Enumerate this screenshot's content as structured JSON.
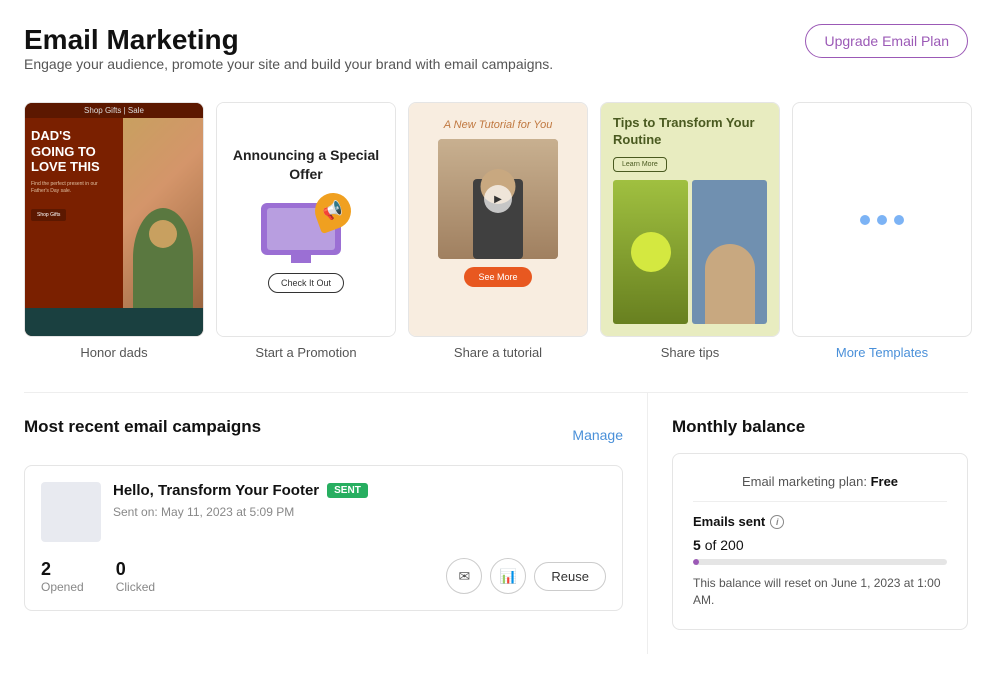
{
  "header": {
    "title": "Email Marketing",
    "subtitle": "Engage your audience, promote your site and build your brand with email campaigns.",
    "upgrade_btn": "Upgrade Email Plan"
  },
  "templates": [
    {
      "id": "honor-dads",
      "label": "Honor dads",
      "top_bar_text": "Shop Gifts | Sale"
    },
    {
      "id": "start-promotion",
      "label": "Start a Promotion",
      "heading": "Announcing a Special Offer",
      "btn_text": "Check It Out"
    },
    {
      "id": "share-tutorial",
      "label": "Share a tutorial",
      "title_text": "A New Tutorial for You",
      "btn_text": "See More"
    },
    {
      "id": "share-tips",
      "label": "Share tips",
      "heading": "Tips to Transform Your Routine",
      "btn_text": "Learn More"
    },
    {
      "id": "more-templates",
      "label": "More Templates"
    }
  ],
  "campaigns": {
    "section_title": "Most recent email campaigns",
    "manage_label": "Manage",
    "items": [
      {
        "title": "Hello, Transform Your Footer",
        "status": "SENT",
        "date": "Sent on: May 11, 2023 at 5:09 PM",
        "opened": "2",
        "opened_label": "Opened",
        "clicked": "0",
        "clicked_label": "Clicked",
        "reuse_label": "Reuse"
      }
    ]
  },
  "monthly_balance": {
    "section_title": "Monthly balance",
    "plan_label": "Email marketing plan:",
    "plan_value": "Free",
    "emails_sent_label": "Emails sent",
    "emails_sent_current": "5",
    "emails_sent_total": "200",
    "emails_sent_display": "5 of 200",
    "progress_percent": 2.5,
    "reset_note": "This balance will reset on June 1, 2023 at 1:00 AM."
  },
  "icons": {
    "envelope": "✉",
    "chart_bar": "📊",
    "info": "i",
    "dots": "• • •"
  }
}
